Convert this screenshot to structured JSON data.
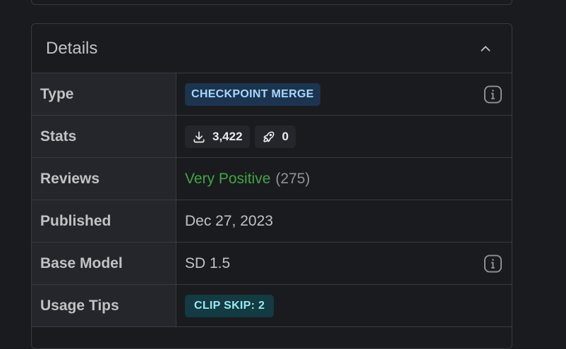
{
  "details": {
    "title": "Details",
    "rows": [
      {
        "label": "Type",
        "badge": "CHECKPOINT MERGE"
      },
      {
        "label": "Stats",
        "downloads": "3,422",
        "generations": "0"
      },
      {
        "label": "Reviews",
        "rating": "Very Positive",
        "count": "(275)"
      },
      {
        "label": "Published",
        "value": "Dec 27, 2023"
      },
      {
        "label": "Base Model",
        "value": "SD 1.5"
      },
      {
        "label": "Usage Tips",
        "badge": "CLIP SKIP: 2"
      }
    ]
  },
  "icons": {
    "collapse": "chevron-up-icon",
    "info": "info-icon",
    "downloads": "download-icon",
    "generations": "rocket-icon"
  },
  "colors": {
    "background": "#1a1b1e",
    "label_background": "#25262b",
    "border": "#373a40",
    "positive": "#40a645",
    "type_badge_bg": "#1c3450",
    "type_badge_fg": "#a5d8ff",
    "tips_badge_bg": "#143a42",
    "tips_badge_fg": "#99e9f2"
  }
}
